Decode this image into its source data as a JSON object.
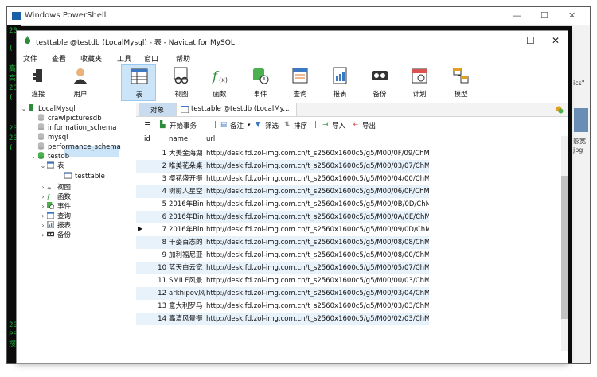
{
  "powershell": {
    "title": "Windows PowerShell",
    "left_lines": [
      "20",
      "(",
      "高",
      "高",
      "20",
      "(",
      "20",
      "20",
      "(",
      "20",
      "PS",
      "搜"
    ],
    "right_text": [
      "ics\"",
      "影宽",
      "jpg"
    ]
  },
  "window": {
    "title": "testtable @testdb (LocalMysql) - 表 - Navicat for MySQL",
    "minimize": "—",
    "maximize": "☐",
    "close": "✕"
  },
  "menu": [
    "文件",
    "查看",
    "收藏夹",
    "工具",
    "窗口",
    "帮助"
  ],
  "toolbar": [
    {
      "label": "连接",
      "icon": "plug-icon"
    },
    {
      "label": "用户",
      "icon": "user-icon"
    },
    {
      "label": "表",
      "icon": "table-icon"
    },
    {
      "label": "视图",
      "icon": "view-icon"
    },
    {
      "label": "函数",
      "icon": "function-icon"
    },
    {
      "label": "事件",
      "icon": "event-icon"
    },
    {
      "label": "查询",
      "icon": "query-icon"
    },
    {
      "label": "报表",
      "icon": "report-icon"
    },
    {
      "label": "备份",
      "icon": "backup-icon"
    },
    {
      "label": "计划",
      "icon": "schedule-icon"
    },
    {
      "label": "模型",
      "icon": "model-icon"
    }
  ],
  "tree": {
    "connection": "LocalMysql",
    "databases": [
      "crawlpicturesdb",
      "information_schema",
      "mysql",
      "performance_schema",
      "testdb"
    ],
    "testdb_children": {
      "tables_label": "表",
      "table": "testtable",
      "others": [
        "视图",
        "函数",
        "事件",
        "查询",
        "报表",
        "备份"
      ]
    }
  },
  "tabs": {
    "objects": "对象",
    "table_tab": "testtable @testdb (LocalMy..."
  },
  "subtoolbar": {
    "menu_icon": "≡",
    "begin_transaction": "开始事务",
    "note": "备注",
    "filter": "筛选",
    "sort": "排序",
    "import": "导入",
    "export": "导出"
  },
  "grid": {
    "columns": [
      "id",
      "name",
      "url"
    ],
    "rows": [
      {
        "id": "1",
        "name": "大美金海湖",
        "url": "http://desk.fd.zol-img.com.cn/t_s2560x1600c5/g5/M00/0F/09/ChMk"
      },
      {
        "id": "2",
        "name": "唯美花朵桌",
        "url": "http://desk.fd.zol-img.com.cn/t_s2560x1600c5/g5/M00/03/07/ChMk"
      },
      {
        "id": "3",
        "name": "樱花盛开摄",
        "url": "http://desk.fd.zol-img.com.cn/t_s2560x1600c5/g5/M00/04/00/ChMk"
      },
      {
        "id": "4",
        "name": "树影人星空",
        "url": "http://desk.fd.zol-img.com.cn/t_s2560x1600c5/g5/M00/06/0F/ChMk"
      },
      {
        "id": "5",
        "name": "2016年Bin",
        "url": "http://desk.fd.zol-img.com.cn/t_s2560x1600c5/g5/M00/0B/0D/ChM"
      },
      {
        "id": "6",
        "name": "2016年Bin",
        "url": "http://desk.fd.zol-img.com.cn/t_s2560x1600c5/g5/M00/0A/0E/ChMl"
      },
      {
        "id": "7",
        "name": "2016年Bin",
        "url": "http://desk.fd.zol-img.com.cn/t_s2560x1600c5/g5/M00/09/0D/ChMl"
      },
      {
        "id": "8",
        "name": "千姿百态的",
        "url": "http://desk.fd.zol-img.com.cn/t_s2560x1600c5/g5/M00/08/08/ChMk"
      },
      {
        "id": "9",
        "name": "加利福尼亚",
        "url": "http://desk.fd.zol-img.com.cn/t_s2560x1600c5/g5/M00/08/00/ChMk"
      },
      {
        "id": "10",
        "name": "蓝天白云宽",
        "url": "http://desk.fd.zol-img.com.cn/t_s2560x1600c5/g5/M00/05/07/ChMk"
      },
      {
        "id": "11",
        "name": "SMILE风景",
        "url": "http://desk.fd.zol-img.com.cn/t_s2560x1600c5/g5/M00/00/03/ChMk"
      },
      {
        "id": "12",
        "name": "arkhipov风",
        "url": "http://desk.fd.zol-img.com.cn/t_s2560x1600c5/g5/M00/03/04/ChMk"
      },
      {
        "id": "13",
        "name": "意大利罗马",
        "url": "http://desk.fd.zol-img.com.cn/t_s2560x1600c5/g5/M00/03/03/ChMk"
      },
      {
        "id": "14",
        "name": "高清风景摄",
        "url": "http://desk.fd.zol-img.com.cn/t_s2560x1600c5/g5/M00/02/03/ChMk"
      }
    ],
    "current_row_indicator": "▶"
  }
}
